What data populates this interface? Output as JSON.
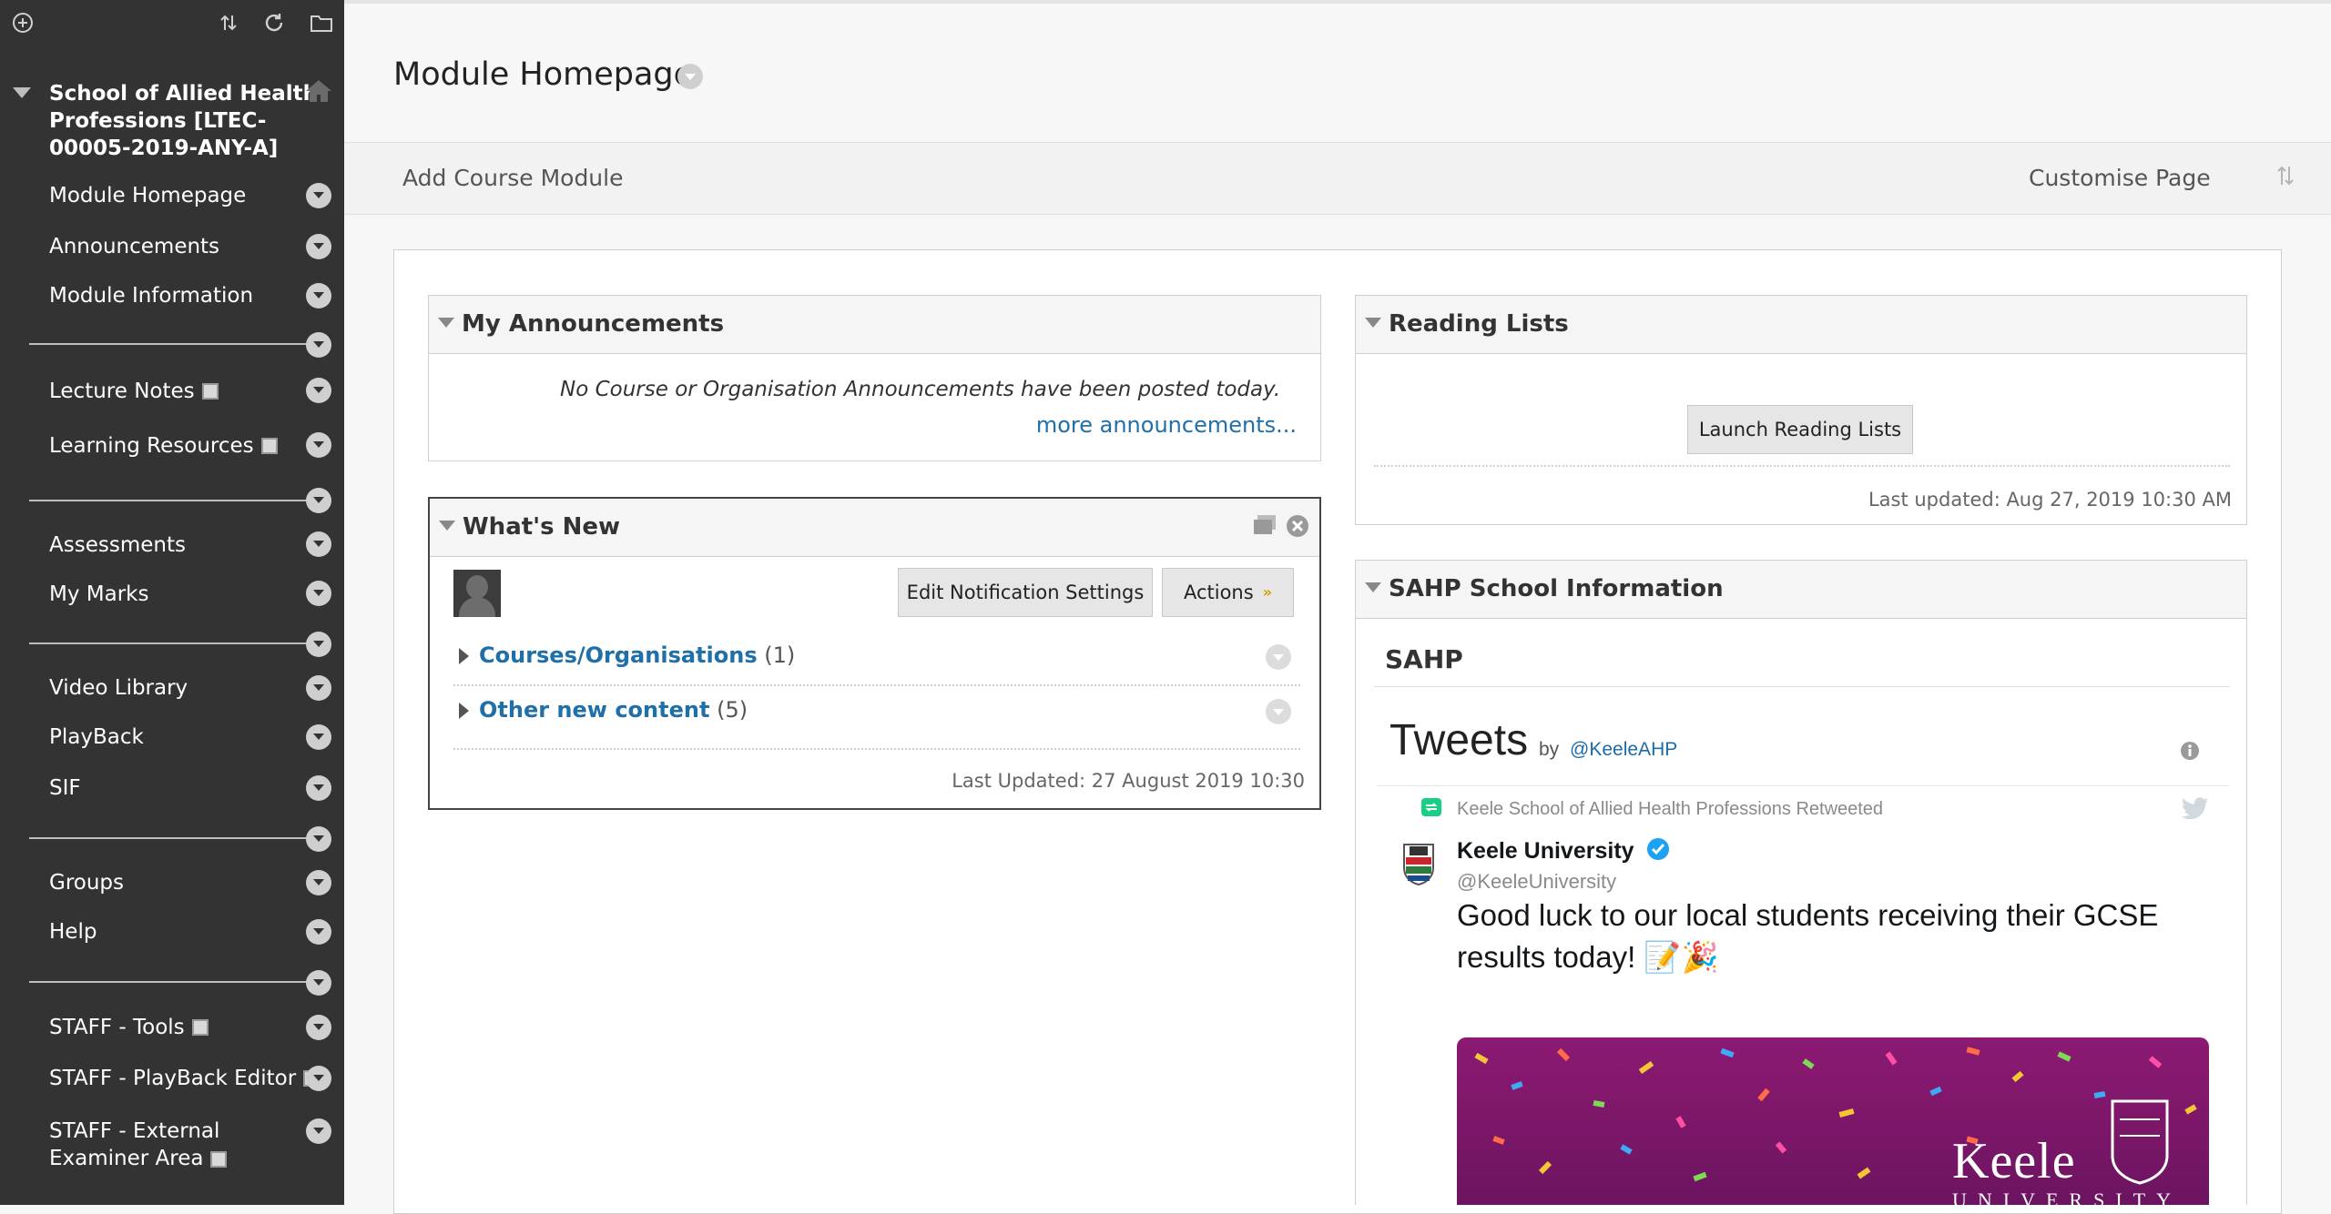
{
  "sidebar": {
    "course_title": "School of Allied Health Professions [LTEC-00005-2019-ANY-A]",
    "items": [
      {
        "label": "Module Homepage"
      },
      {
        "label": "Announcements"
      },
      {
        "label": "Module Information"
      },
      {
        "label": "Lecture Notes"
      },
      {
        "label": "Learning Resources"
      },
      {
        "label": "Assessments"
      },
      {
        "label": "My Marks"
      },
      {
        "label": "Video Library"
      },
      {
        "label": "PlayBack"
      },
      {
        "label": "SIF"
      },
      {
        "label": "Groups"
      },
      {
        "label": "Help"
      },
      {
        "label": "STAFF - Tools"
      },
      {
        "label": "STAFF - PlayBack Editor"
      },
      {
        "label": "STAFF - External Examiner Area"
      }
    ]
  },
  "page": {
    "title": "Module Homepage",
    "add_module": "Add Course Module",
    "customise": "Customise Page"
  },
  "announcements": {
    "title": "My Announcements",
    "empty_msg": "No Course or Organisation Announcements have been posted today.",
    "more_link": "more announcements..."
  },
  "whats_new": {
    "title": "What's New",
    "edit_btn": "Edit Notification Settings",
    "actions_btn": "Actions",
    "rows": [
      {
        "label": "Courses/Organisations",
        "count": "(1)"
      },
      {
        "label": "Other new content",
        "count": "(5)"
      }
    ],
    "updated": "Last Updated: 27 August 2019 10:30"
  },
  "reading_lists": {
    "title": "Reading Lists",
    "launch_btn": "Launch Reading Lists",
    "updated": "Last updated: Aug 27, 2019 10:30 AM"
  },
  "school_info": {
    "title": "SAHP School Information",
    "heading": "SAHP",
    "tweets_title": "Tweets",
    "tweets_by": "by",
    "tweets_handle": "@KeeleAHP",
    "retweet_note": "Keele School of Allied Health Professions Retweeted",
    "tweet_name": "Keele University",
    "tweet_handle": "@KeeleUniversity",
    "tweet_text": "Good luck to our local students receiving their GCSE results today! 📝🎉",
    "image_brand": "Keele",
    "image_sub": "UNIVERSITY"
  },
  "colors": {
    "sidebar_bg": "#333333",
    "link": "#1f6fa8",
    "twitter_blue": "#1da1f2",
    "confetti_bg": "#8c1a72"
  }
}
